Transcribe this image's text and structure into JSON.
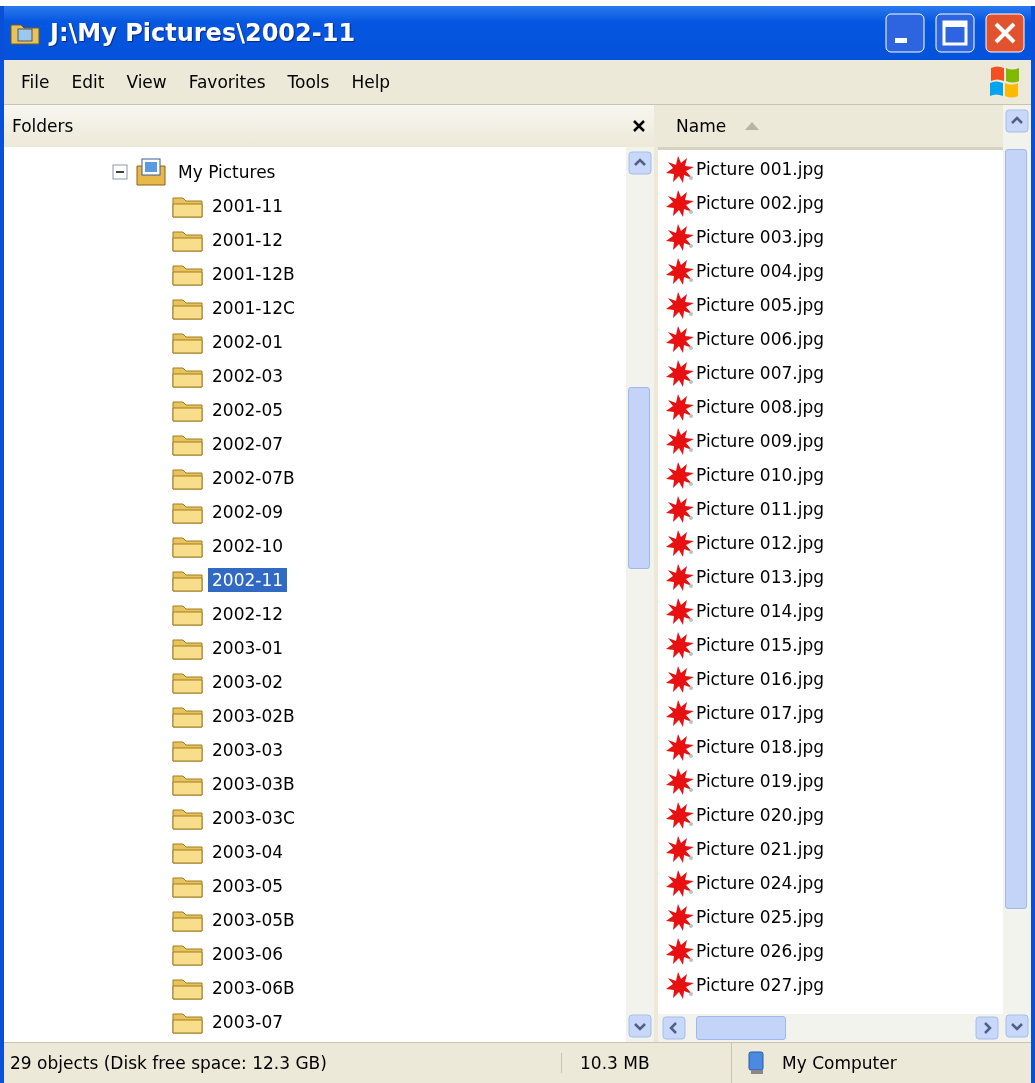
{
  "window": {
    "title": "J:\\My Pictures\\2002-11"
  },
  "menu": [
    "File",
    "Edit",
    "View",
    "Favorites",
    "Tools",
    "Help"
  ],
  "folders_pane": {
    "title": "Folders",
    "tree": [
      {
        "label": "My Pictures",
        "expanded": true,
        "children": [
          {
            "label": "2001-11",
            "selected": false
          },
          {
            "label": "2001-12",
            "selected": false
          },
          {
            "label": "2001-12B",
            "selected": false
          },
          {
            "label": "2001-12C",
            "selected": false
          },
          {
            "label": "2002-01",
            "selected": false
          },
          {
            "label": "2002-03",
            "selected": false
          },
          {
            "label": "2002-05",
            "selected": false
          },
          {
            "label": "2002-07",
            "selected": false
          },
          {
            "label": "2002-07B",
            "selected": false
          },
          {
            "label": "2002-09",
            "selected": false
          },
          {
            "label": "2002-10",
            "selected": false
          },
          {
            "label": "2002-11",
            "selected": true
          },
          {
            "label": "2002-12",
            "selected": false
          },
          {
            "label": "2003-01",
            "selected": false
          },
          {
            "label": "2003-02",
            "selected": false
          },
          {
            "label": "2003-02B",
            "selected": false
          },
          {
            "label": "2003-03",
            "selected": false
          },
          {
            "label": "2003-03B",
            "selected": false
          },
          {
            "label": "2003-03C",
            "selected": false
          },
          {
            "label": "2003-04",
            "selected": false
          },
          {
            "label": "2003-05",
            "selected": false
          },
          {
            "label": "2003-05B",
            "selected": false
          },
          {
            "label": "2003-06",
            "selected": false
          },
          {
            "label": "2003-06B",
            "selected": false
          },
          {
            "label": "2003-07",
            "selected": false
          }
        ]
      }
    ]
  },
  "file_list": {
    "column": "Name",
    "files": [
      "Picture 001.jpg",
      "Picture 002.jpg",
      "Picture 003.jpg",
      "Picture 004.jpg",
      "Picture 005.jpg",
      "Picture 006.jpg",
      "Picture 007.jpg",
      "Picture 008.jpg",
      "Picture 009.jpg",
      "Picture 010.jpg",
      "Picture 011.jpg",
      "Picture 012.jpg",
      "Picture 013.jpg",
      "Picture 014.jpg",
      "Picture 015.jpg",
      "Picture 016.jpg",
      "Picture 017.jpg",
      "Picture 018.jpg",
      "Picture 019.jpg",
      "Picture 020.jpg",
      "Picture 021.jpg",
      "Picture 024.jpg",
      "Picture 025.jpg",
      "Picture 026.jpg",
      "Picture 027.jpg"
    ]
  },
  "status_bar": {
    "objects": "29 objects (Disk free space: 12.3 GB)",
    "size": "10.3 MB",
    "location": "My Computer"
  }
}
